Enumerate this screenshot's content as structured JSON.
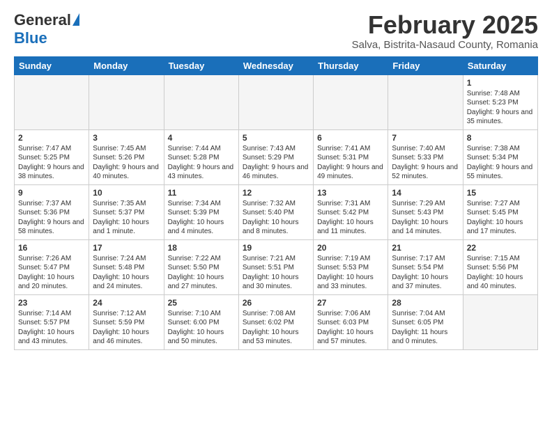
{
  "header": {
    "logo_general": "General",
    "logo_blue": "Blue",
    "month_title": "February 2025",
    "subtitle": "Salva, Bistrita-Nasaud County, Romania"
  },
  "weekdays": [
    "Sunday",
    "Monday",
    "Tuesday",
    "Wednesday",
    "Thursday",
    "Friday",
    "Saturday"
  ],
  "weeks": [
    [
      {
        "day": "",
        "info": ""
      },
      {
        "day": "",
        "info": ""
      },
      {
        "day": "",
        "info": ""
      },
      {
        "day": "",
        "info": ""
      },
      {
        "day": "",
        "info": ""
      },
      {
        "day": "",
        "info": ""
      },
      {
        "day": "1",
        "info": "Sunrise: 7:48 AM\nSunset: 5:23 PM\nDaylight: 9 hours and 35 minutes."
      }
    ],
    [
      {
        "day": "2",
        "info": "Sunrise: 7:47 AM\nSunset: 5:25 PM\nDaylight: 9 hours and 38 minutes."
      },
      {
        "day": "3",
        "info": "Sunrise: 7:45 AM\nSunset: 5:26 PM\nDaylight: 9 hours and 40 minutes."
      },
      {
        "day": "4",
        "info": "Sunrise: 7:44 AM\nSunset: 5:28 PM\nDaylight: 9 hours and 43 minutes."
      },
      {
        "day": "5",
        "info": "Sunrise: 7:43 AM\nSunset: 5:29 PM\nDaylight: 9 hours and 46 minutes."
      },
      {
        "day": "6",
        "info": "Sunrise: 7:41 AM\nSunset: 5:31 PM\nDaylight: 9 hours and 49 minutes."
      },
      {
        "day": "7",
        "info": "Sunrise: 7:40 AM\nSunset: 5:33 PM\nDaylight: 9 hours and 52 minutes."
      },
      {
        "day": "8",
        "info": "Sunrise: 7:38 AM\nSunset: 5:34 PM\nDaylight: 9 hours and 55 minutes."
      }
    ],
    [
      {
        "day": "9",
        "info": "Sunrise: 7:37 AM\nSunset: 5:36 PM\nDaylight: 9 hours and 58 minutes."
      },
      {
        "day": "10",
        "info": "Sunrise: 7:35 AM\nSunset: 5:37 PM\nDaylight: 10 hours and 1 minute."
      },
      {
        "day": "11",
        "info": "Sunrise: 7:34 AM\nSunset: 5:39 PM\nDaylight: 10 hours and 4 minutes."
      },
      {
        "day": "12",
        "info": "Sunrise: 7:32 AM\nSunset: 5:40 PM\nDaylight: 10 hours and 8 minutes."
      },
      {
        "day": "13",
        "info": "Sunrise: 7:31 AM\nSunset: 5:42 PM\nDaylight: 10 hours and 11 minutes."
      },
      {
        "day": "14",
        "info": "Sunrise: 7:29 AM\nSunset: 5:43 PM\nDaylight: 10 hours and 14 minutes."
      },
      {
        "day": "15",
        "info": "Sunrise: 7:27 AM\nSunset: 5:45 PM\nDaylight: 10 hours and 17 minutes."
      }
    ],
    [
      {
        "day": "16",
        "info": "Sunrise: 7:26 AM\nSunset: 5:47 PM\nDaylight: 10 hours and 20 minutes."
      },
      {
        "day": "17",
        "info": "Sunrise: 7:24 AM\nSunset: 5:48 PM\nDaylight: 10 hours and 24 minutes."
      },
      {
        "day": "18",
        "info": "Sunrise: 7:22 AM\nSunset: 5:50 PM\nDaylight: 10 hours and 27 minutes."
      },
      {
        "day": "19",
        "info": "Sunrise: 7:21 AM\nSunset: 5:51 PM\nDaylight: 10 hours and 30 minutes."
      },
      {
        "day": "20",
        "info": "Sunrise: 7:19 AM\nSunset: 5:53 PM\nDaylight: 10 hours and 33 minutes."
      },
      {
        "day": "21",
        "info": "Sunrise: 7:17 AM\nSunset: 5:54 PM\nDaylight: 10 hours and 37 minutes."
      },
      {
        "day": "22",
        "info": "Sunrise: 7:15 AM\nSunset: 5:56 PM\nDaylight: 10 hours and 40 minutes."
      }
    ],
    [
      {
        "day": "23",
        "info": "Sunrise: 7:14 AM\nSunset: 5:57 PM\nDaylight: 10 hours and 43 minutes."
      },
      {
        "day": "24",
        "info": "Sunrise: 7:12 AM\nSunset: 5:59 PM\nDaylight: 10 hours and 46 minutes."
      },
      {
        "day": "25",
        "info": "Sunrise: 7:10 AM\nSunset: 6:00 PM\nDaylight: 10 hours and 50 minutes."
      },
      {
        "day": "26",
        "info": "Sunrise: 7:08 AM\nSunset: 6:02 PM\nDaylight: 10 hours and 53 minutes."
      },
      {
        "day": "27",
        "info": "Sunrise: 7:06 AM\nSunset: 6:03 PM\nDaylight: 10 hours and 57 minutes."
      },
      {
        "day": "28",
        "info": "Sunrise: 7:04 AM\nSunset: 6:05 PM\nDaylight: 11 hours and 0 minutes."
      },
      {
        "day": "",
        "info": ""
      }
    ]
  ]
}
